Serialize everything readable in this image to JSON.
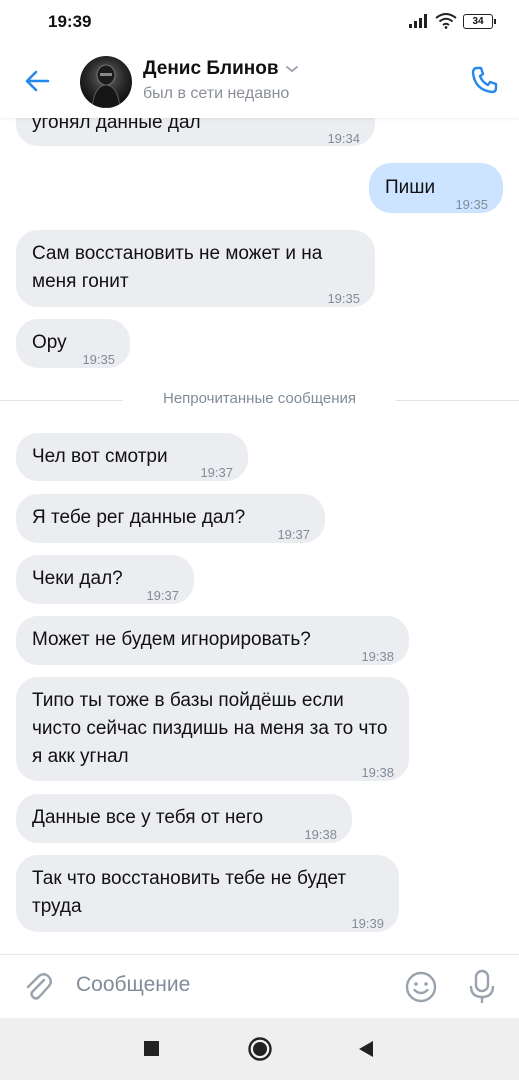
{
  "status_bar": {
    "time": "19:39",
    "battery": "34"
  },
  "header": {
    "contact_name": "Денис Блинов",
    "contact_status": "был в сети недавно"
  },
  "messages": [
    {
      "dir": "in",
      "text": "угонял данные дал",
      "time": "19:34"
    },
    {
      "dir": "out",
      "text": "Пиши",
      "time": "19:35"
    },
    {
      "dir": "in",
      "text": "Сам восстановить не может и на меня гонит",
      "time": "19:35"
    },
    {
      "dir": "in",
      "text": "Ору",
      "time": "19:35"
    },
    {
      "dir": "in",
      "text": "Чел вот смотри",
      "time": "19:37"
    },
    {
      "dir": "in",
      "text": "Я тебе рег данные дал?",
      "time": "19:37"
    },
    {
      "dir": "in",
      "text": "Чеки дал?",
      "time": "19:37"
    },
    {
      "dir": "in",
      "text": "Может не будем игнорировать?",
      "time": "19:38"
    },
    {
      "dir": "in",
      "text": "Типо ты тоже в базы пойдёшь если чисто сейчас пиздишь на меня за то что я акк угнал",
      "time": "19:38"
    },
    {
      "dir": "in",
      "text": "Данные все у тебя от него",
      "time": "19:38"
    },
    {
      "dir": "in",
      "text": "Так что восстановить тебе не будет труда",
      "time": "19:39"
    }
  ],
  "unread_divider": "Непрочитанные сообщения",
  "composer": {
    "placeholder": "Сообщение"
  },
  "colors": {
    "accent": "#2688eb",
    "incoming_bubble": "#ebedf0",
    "outgoing_bubble": "#cce4ff"
  }
}
